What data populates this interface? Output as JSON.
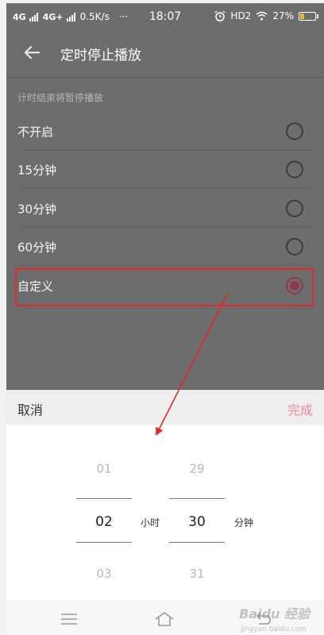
{
  "status": {
    "net1": "4G",
    "net2": "4G+",
    "speed": "0.5K/s",
    "dots": "···",
    "time": "18:07",
    "hd": "HD2",
    "battery": "27%",
    "battery_level": 0.27
  },
  "header": {
    "title": "定时停止播放"
  },
  "section_hint": "计时结束将暂停播放",
  "options": [
    {
      "label": "不开启",
      "selected": false
    },
    {
      "label": "15分钟",
      "selected": false
    },
    {
      "label": "30分钟",
      "selected": false
    },
    {
      "label": "60分钟",
      "selected": false
    },
    {
      "label": "自定义",
      "selected": true
    }
  ],
  "sheet": {
    "cancel": "取消",
    "done": "完成"
  },
  "picker": {
    "hours": {
      "prev": "01",
      "selected": "02",
      "next": "03",
      "unit": "小时"
    },
    "minutes": {
      "prev": "29",
      "selected": "30",
      "next": "31",
      "unit": "分钟"
    }
  },
  "watermark": {
    "brand": "Baidu 经验",
    "site": "jingyan.baidu.com"
  },
  "colors": {
    "accent": "#f08a9b",
    "radio_on": "#8b3a4a",
    "annotation": "#e8262c"
  }
}
